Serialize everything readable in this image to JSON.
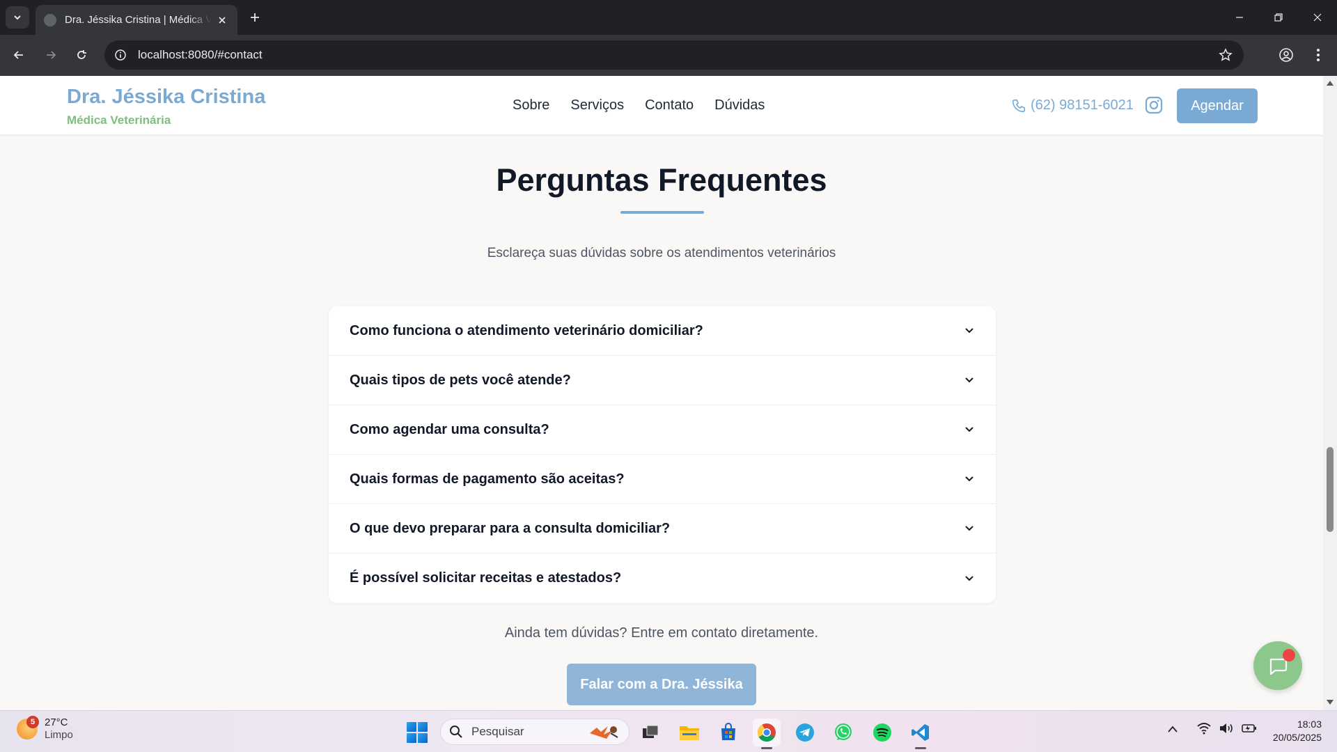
{
  "browser": {
    "tab_title": "Dra. Jéssika Cristina | Médica Veterinária",
    "url": "localhost:8080/#contact"
  },
  "site": {
    "brand_name": "Dra. Jéssika Cristina",
    "brand_subtitle": "Médica Veterinária",
    "nav": [
      "Sobre",
      "Serviços",
      "Contato",
      "Dúvidas"
    ],
    "phone": "(62) 98151-6021",
    "cta_label": "Agendar"
  },
  "faq": {
    "title": "Perguntas Frequentes",
    "subtitle": "Esclareça suas dúvidas sobre os atendimentos veterinários",
    "questions": [
      "Como funciona o atendimento veterinário domiciliar?",
      "Quais tipos de pets você atende?",
      "Como agendar uma consulta?",
      "Quais formas de pagamento são aceitas?",
      "O que devo preparar para a consulta domiciliar?",
      "É possível solicitar receitas e atestados?"
    ],
    "more_text": "Ainda tem dúvidas? Entre em contato diretamente.",
    "contact_button": "Falar com a Dra. Jéssika"
  },
  "colors": {
    "brand_blue": "#7aaad3",
    "brand_green": "#7cc07c",
    "chat_green": "#8cc78c",
    "notification_red": "#ef4444"
  },
  "taskbar": {
    "weather_badge": "5",
    "weather_temp": "27°C",
    "weather_desc": "Limpo",
    "search_placeholder": "Pesquisar",
    "time": "18:03",
    "date": "20/05/2025"
  }
}
